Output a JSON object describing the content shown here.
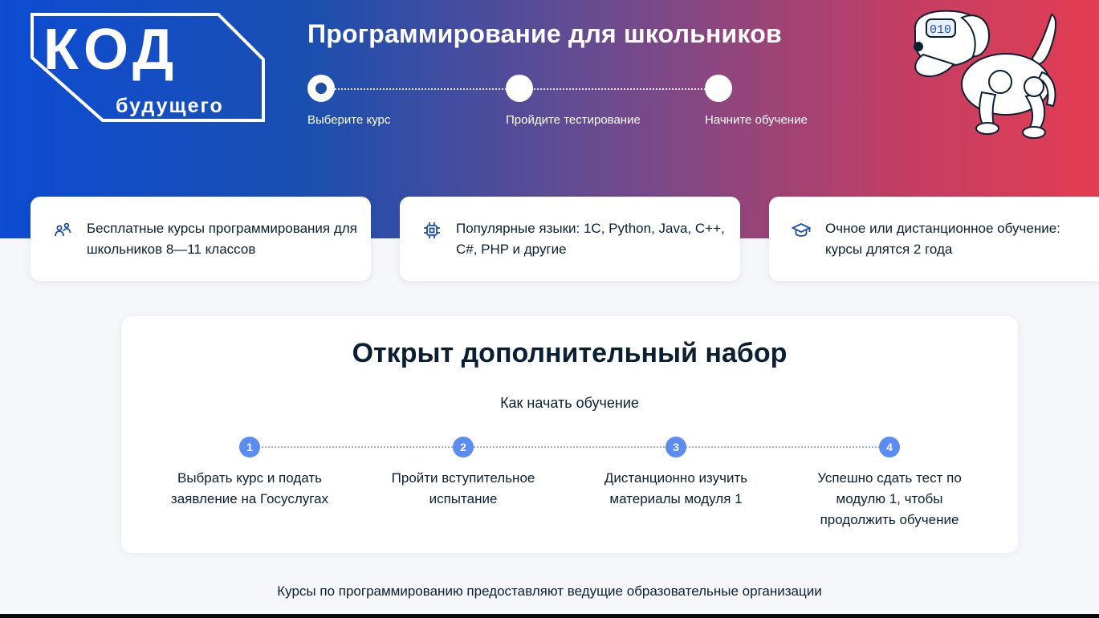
{
  "logo": {
    "main": "КОД",
    "sub": "будущего"
  },
  "hero": {
    "title": "Программирование для школьников",
    "steps": [
      {
        "label": "Выберите курс",
        "active": true
      },
      {
        "label": "Пройдите тестирование",
        "active": false
      },
      {
        "label": "Начните обучение",
        "active": false
      }
    ],
    "mascot_badge": "010"
  },
  "features": [
    {
      "icon": "students-icon",
      "text": "Бесплатные курсы программирования для школьников 8—11 классов"
    },
    {
      "icon": "chip-icon",
      "text": "Популярные языки: 1С, Python, Java, С++, С#, PHP и другие"
    },
    {
      "icon": "graduation-cap-icon",
      "text": "Очное или дистанционное обучение: курсы длятся 2 года"
    }
  ],
  "main": {
    "title": "Открыт дополнительный набор",
    "subtitle": "Как начать обучение",
    "steps": [
      {
        "num": "1",
        "text": "Выбрать курс и подать заявление на Госуслугах"
      },
      {
        "num": "2",
        "text": "Пройти вступительное испытание"
      },
      {
        "num": "3",
        "text": "Дистанционно изучить материалы модуля 1"
      },
      {
        "num": "4",
        "text": "Успешно сдать тест по модулю 1, чтобы продолжить обучение"
      }
    ]
  },
  "footer": {
    "note": "Курсы по программированию предоставляют ведущие образовательные организации"
  },
  "colors": {
    "brand_blue": "#0d4cd3",
    "brand_red": "#e43d52",
    "step_blue": "#5b8cf2",
    "text_dark": "#0b1f33"
  }
}
